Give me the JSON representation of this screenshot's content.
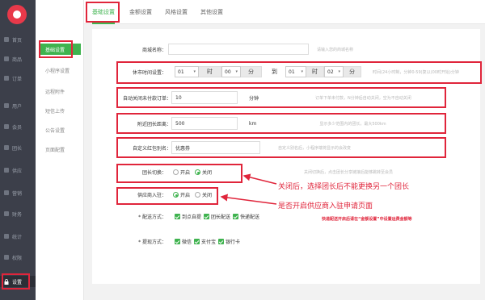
{
  "sidebar": {
    "items": [
      {
        "label": "首页"
      },
      {
        "label": "商品"
      },
      {
        "label": "订单"
      },
      {
        "label": "用户"
      },
      {
        "label": "会员"
      },
      {
        "label": "团长"
      },
      {
        "label": "供应"
      },
      {
        "label": "营销"
      },
      {
        "label": "财务"
      },
      {
        "label": "统计"
      },
      {
        "label": "权限"
      },
      {
        "label": "设置"
      }
    ]
  },
  "sub_sidebar": {
    "items": [
      {
        "label": "基础设置"
      },
      {
        "label": "小程序设置"
      },
      {
        "label": "远程附件"
      },
      {
        "label": "短信上传"
      },
      {
        "label": "公告设置"
      },
      {
        "label": "页面配置"
      }
    ]
  },
  "tabs": [
    {
      "label": "基础设置"
    },
    {
      "label": "金额设置"
    },
    {
      "label": "风格设置"
    },
    {
      "label": "其他设置"
    }
  ],
  "form": {
    "shop_name": {
      "label": "商城名称：",
      "value": "",
      "hint": "请输入您的商城名称"
    },
    "rest_time": {
      "label": "休市时间设置：",
      "start_hour": "01",
      "hour_unit": "时",
      "start_min": "00",
      "min_unit": "分",
      "to": "到",
      "end_hour": "01",
      "end_min": "02",
      "hint": "时间(24小时制，分钟0-59)复以(00时开始)分钟"
    },
    "auto_close": {
      "label": "自动关闭未付款订单：",
      "value": "10",
      "unit": "分钟",
      "hint": "订单下单未付款，N分钟后自动关闭，空为不自动关闭"
    },
    "nearby_distance": {
      "label": "附近团长距离：",
      "value": "500",
      "unit": "km",
      "hint": "显示多少范围内的团长，最大500km"
    },
    "custom_alias": {
      "label": "自定义红包别名：",
      "value": "优惠券",
      "hint": "自定义别名后，小程序端将显示的会改变"
    },
    "leader_switch": {
      "label": "团长切换：",
      "opt_on": "开启",
      "opt_off": "关闭",
      "selected": "关闭",
      "hint": "关闭切换后，点击团长分享链接后能够跳转至会员"
    },
    "supplier_join": {
      "label": "供应商入驻：",
      "opt_on": "开启",
      "opt_off": "关闭",
      "selected": "开启"
    },
    "delivery": {
      "label": "* 配送方式：",
      "options": [
        "到点自提",
        "团长配送",
        "快递配送"
      ]
    },
    "withdraw": {
      "label": "* 提现方式：",
      "options": [
        "微信",
        "支付宝",
        "银行卡"
      ]
    }
  },
  "annotations": {
    "leader_note": "关闭后，选择团长后不能更换另一个团长",
    "supplier_note": "是否开启供应商入驻申请页面",
    "express_note": "快递配送开启后请在“金额设置”中设置运费金额等"
  },
  "colors": {
    "accent": "#3fb34f",
    "alert": "#e0253b",
    "sidebar": "#3c3f4a"
  }
}
